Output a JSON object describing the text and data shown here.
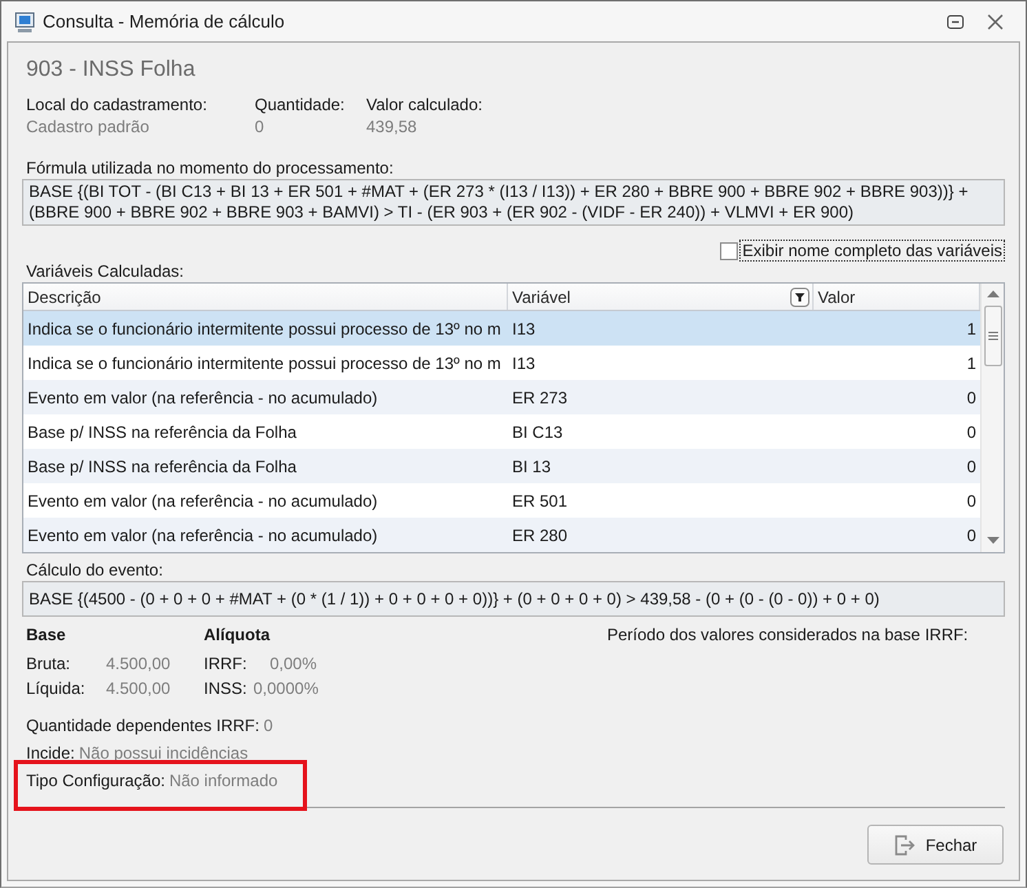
{
  "window": {
    "title": "Consulta - Memória de cálculo"
  },
  "heading": "903 - INSS Folha",
  "info": [
    {
      "label": "Local do cadastramento:",
      "value": "Cadastro padrão"
    },
    {
      "label": "Quantidade:",
      "value": "0"
    },
    {
      "label": "Valor calculado:",
      "value": "439,58"
    }
  ],
  "formula": {
    "label": "Fórmula utilizada no momento do processamento:",
    "text": "BASE {(BI TOT - (BI C13 + BI 13 + ER 501 + #MAT + (ER 273 * (I13 / I13)) + ER 280 + BBRE 900 + BBRE 902 + BBRE 903))} + (BBRE 900 + BBRE 902 + BBRE 903 + BAMVI) > TI - (ER 903 + (ER 902 - (VIDF - ER 240)) + VLMVI + ER 900)"
  },
  "show_full_names": {
    "label": "Exibir nome completo das variáveis",
    "checked": false
  },
  "variables": {
    "label": "Variáveis Calculadas:",
    "columns": [
      {
        "label": "Descrição",
        "filter": false
      },
      {
        "label": "Variável",
        "filter": true
      },
      {
        "label": "Valor",
        "filter": false
      }
    ],
    "rows": [
      {
        "description": "Indica se o funcionário intermitente possui processo de 13º no m",
        "variable": "I13",
        "value": "1",
        "selected": true
      },
      {
        "description": "Indica se o funcionário intermitente possui processo de 13º no m",
        "variable": "I13",
        "value": "1",
        "selected": false
      },
      {
        "description": "Evento em valor (na referência - no acumulado)",
        "variable": "ER 273",
        "value": "0",
        "selected": false
      },
      {
        "description": "Base p/ INSS na referência da Folha",
        "variable": "BI C13",
        "value": "0",
        "selected": false
      },
      {
        "description": "Base p/ INSS na referência da Folha",
        "variable": "BI 13",
        "value": "0",
        "selected": false
      },
      {
        "description": "Evento em valor (na referência - no acumulado)",
        "variable": "ER 501",
        "value": "0",
        "selected": false
      },
      {
        "description": "Evento em valor (na referência - no acumulado)",
        "variable": "ER 280",
        "value": "0",
        "selected": false
      }
    ]
  },
  "event_calculation": {
    "label": "Cálculo do evento:",
    "text": "BASE {(4500 - (0 + 0 + 0 + #MAT + (0 * (1 / 1)) + 0 + 0 + 0 + 0))} + (0 + 0 + 0 + 0) > 439,58 - (0 + (0 - (0 - 0)) + 0 + 0)"
  },
  "base": {
    "title": "Base",
    "items": [
      {
        "label": "Bruta:",
        "value": "4.500,00"
      },
      {
        "label": "Líquida:",
        "value": "4.500,00"
      }
    ]
  },
  "rate": {
    "title": "Alíquota",
    "items": [
      {
        "label": "IRRF:",
        "value": "0,00%"
      },
      {
        "label": "INSS:",
        "value": "0,0000%"
      }
    ]
  },
  "irrf_period": {
    "label": "Período dos valores considerados na base IRRF:"
  },
  "details": [
    {
      "label": "Quantidade dependentes IRRF:",
      "value": "0",
      "highlighted": false
    },
    {
      "label": "Incide:",
      "value": "Não possui incidências",
      "highlighted": false
    },
    {
      "label": "Tipo Configuração:",
      "value": "Não informado",
      "highlighted": true
    }
  ],
  "buttons": [
    {
      "label": "Fechar"
    }
  ]
}
